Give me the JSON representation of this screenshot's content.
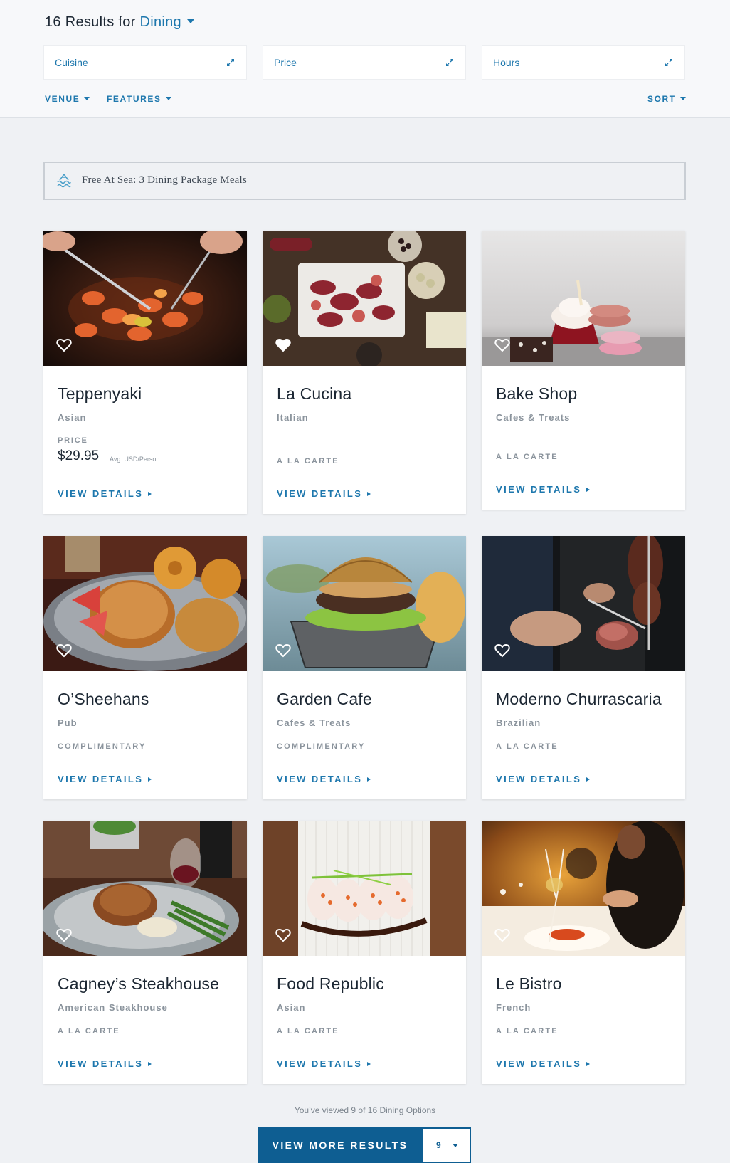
{
  "header": {
    "results_prefix": "16 Results for",
    "results_category": "Dining",
    "filters": [
      {
        "label": "Cuisine"
      },
      {
        "label": "Price"
      },
      {
        "label": "Hours"
      }
    ],
    "venue_label": "VENUE",
    "features_label": "FEATURES",
    "sort_label": "SORT"
  },
  "promo": {
    "text": "Free At Sea: 3 Dining Package Meals"
  },
  "cards": [
    {
      "name": "Teppenyaki",
      "cuisine": "Asian",
      "price_label": "PRICE",
      "price": "$29.95",
      "price_note": "Avg. USD/Person",
      "details": "VIEW DETAILS",
      "favorited": false
    },
    {
      "name": "La Cucina",
      "cuisine": "Italian",
      "meal": "A LA CARTE",
      "details": "VIEW DETAILS",
      "favorited": true
    },
    {
      "name": "Bake Shop",
      "cuisine": "Cafes & Treats",
      "meal": "A LA CARTE",
      "details": "VIEW DETAILS",
      "favorited": false
    },
    {
      "name": "O’Sheehans",
      "cuisine": "Pub",
      "meal": "COMPLIMENTARY",
      "details": "VIEW DETAILS",
      "favorited": false
    },
    {
      "name": "Garden Cafe",
      "cuisine": "Cafes & Treats",
      "meal": "COMPLIMENTARY",
      "details": "VIEW DETAILS",
      "favorited": false
    },
    {
      "name": "Moderno Churrascaria",
      "cuisine": "Brazilian",
      "meal": "A LA CARTE",
      "details": "VIEW DETAILS",
      "favorited": false
    },
    {
      "name": "Cagney’s Steakhouse",
      "cuisine": "American Steakhouse",
      "meal": "A LA CARTE",
      "details": "VIEW DETAILS",
      "favorited": false
    },
    {
      "name": "Food Republic",
      "cuisine": "Asian",
      "meal": "A LA CARTE",
      "details": "VIEW DETAILS",
      "favorited": false
    },
    {
      "name": "Le Bistro",
      "cuisine": "French",
      "meal": "A LA CARTE",
      "details": "VIEW DETAILS",
      "favorited": false
    }
  ],
  "footer": {
    "viewed_text": "You’ve viewed 9 of 16 Dining Options",
    "more_button": "VIEW MORE RESULTS",
    "page_size": "9"
  },
  "colors": {
    "accent": "#1d77ad",
    "button": "#0e5e92",
    "background": "#eff1f4"
  },
  "icons": [
    "expand-icon",
    "chevron-down-icon",
    "waves-icon",
    "heart-icon",
    "arrow-right-icon"
  ]
}
